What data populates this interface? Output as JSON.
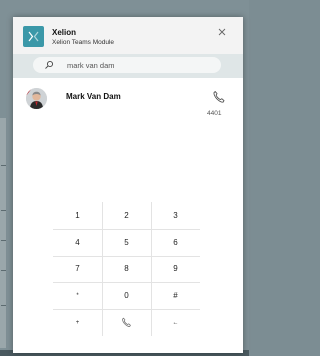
{
  "app": {
    "name": "Xelion",
    "subtitle": "Xelion Teams Module",
    "logo_icon": "xelion-logo-icon",
    "brand_color": "#3b98a8"
  },
  "header": {
    "close_icon": "close-icon"
  },
  "search": {
    "value": "mark van dam",
    "icon": "search-icon"
  },
  "result": {
    "name": "Mark Van Dam",
    "extension": "4401",
    "avatar_icon": "avatar-photo",
    "call_icon": "phone-icon"
  },
  "keypad": {
    "keys": [
      "1",
      "2",
      "3",
      "4",
      "5",
      "6",
      "7",
      "8",
      "9",
      "*",
      "0",
      "#",
      "+",
      "phone-icon",
      "←"
    ]
  }
}
